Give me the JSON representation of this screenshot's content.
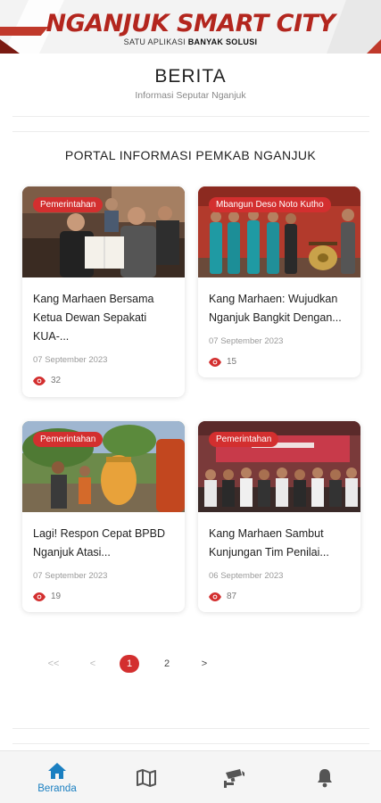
{
  "header": {
    "brand_title": "NGANJUK SMART CITY",
    "brand_sub_prefix": "SATU APLIKASI ",
    "brand_sub_bold": "BANYAK SOLUSI"
  },
  "page": {
    "title": "BERITA",
    "subtitle": "Informasi Seputar Nganjuk",
    "section_title": "PORTAL INFORMASI PEMKAB NGANJUK"
  },
  "cards": [
    {
      "category": "Pemerintahan",
      "title": "Kang Marhaen Bersama Ketua Dewan Sepakati KUA-...",
      "date": "07 September 2023",
      "views": "32"
    },
    {
      "category": "Mbangun Deso Noto Kutho",
      "title": "Kang Marhaen: Wujudkan Nganjuk Bangkit Dengan...",
      "date": "07 September 2023",
      "views": "15"
    },
    {
      "category": "Pemerintahan",
      "title": "Lagi! Respon Cepat BPBD Nganjuk Atasi...",
      "date": "07 September 2023",
      "views": "19"
    },
    {
      "category": "Pemerintahan",
      "title": "Kang Marhaen Sambut Kunjungan Tim Penilai...",
      "date": "06 September 2023",
      "views": "87"
    }
  ],
  "pagination": {
    "first": "<<",
    "prev": "<",
    "pages": [
      "1",
      "2"
    ],
    "current": "1",
    "next": ">"
  },
  "bottom_nav": {
    "items": [
      {
        "label": "Beranda",
        "icon": "home-icon",
        "active": true
      },
      {
        "label": "",
        "icon": "map-icon",
        "active": false
      },
      {
        "label": "",
        "icon": "cctv-icon",
        "active": false
      },
      {
        "label": "",
        "icon": "bell-icon",
        "active": false
      }
    ],
    "active_color": "#1a7fc1",
    "inactive_color": "#555555"
  },
  "colors": {
    "brand_red": "#b3261e",
    "badge_red": "#d32f2f"
  }
}
